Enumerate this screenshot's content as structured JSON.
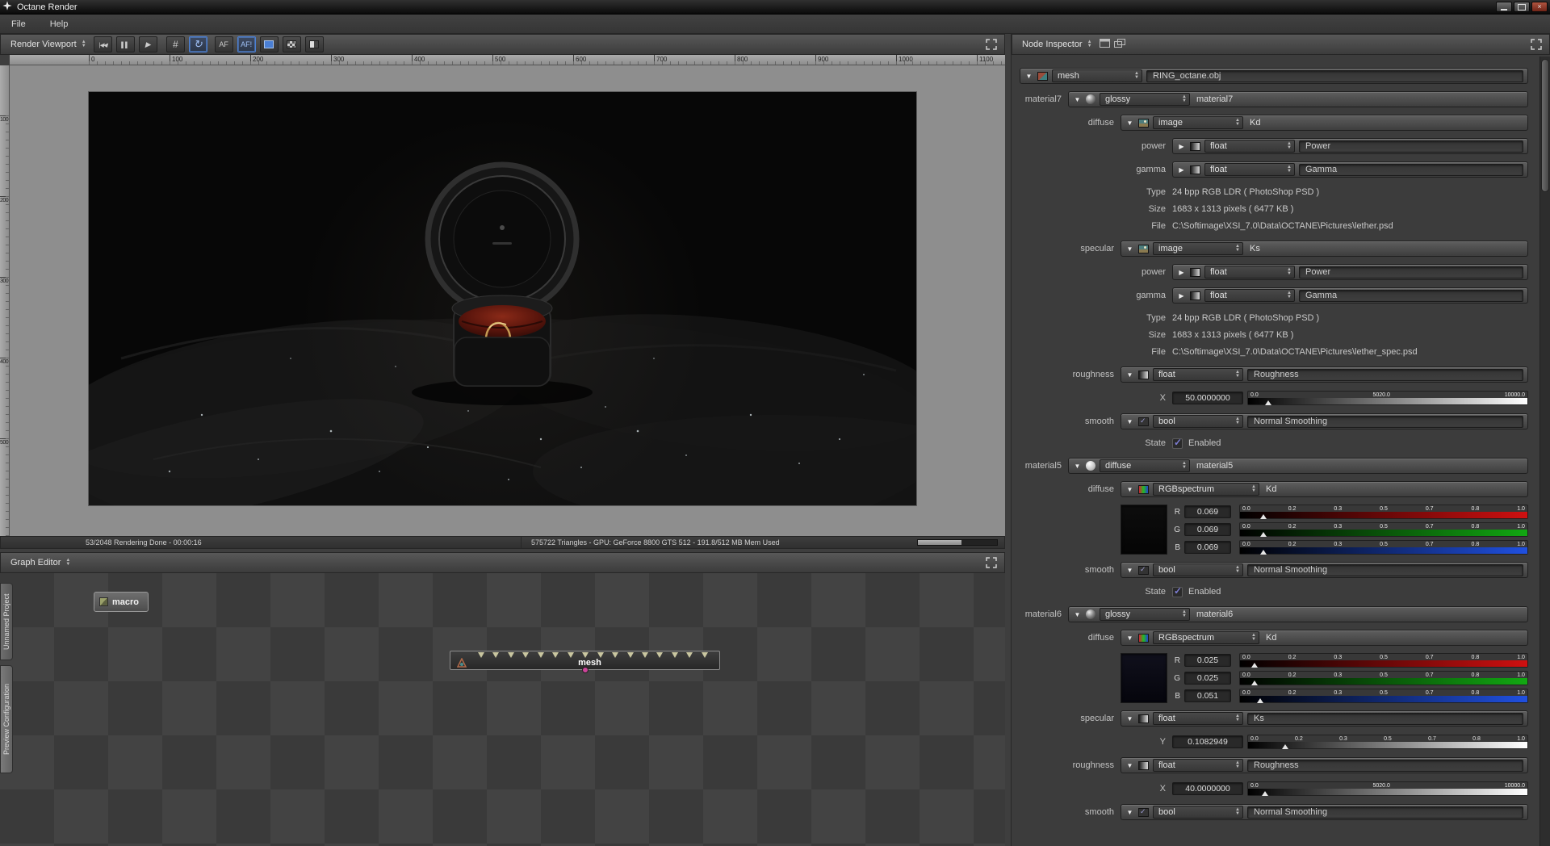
{
  "colors": {
    "accent": "#4a7fd4",
    "check": "#7d7dd4",
    "red": "#d01010",
    "green": "#12a812",
    "blue": "#2050e0",
    "pin": "#c9c6a0",
    "outpin": "#cc4499"
  },
  "window": {
    "title": "Octane Render",
    "menu_file": "File",
    "menu_help": "Help"
  },
  "viewport": {
    "title": "Render Viewport",
    "af": "AF",
    "af2": "AF!",
    "ruler_h": [
      "0",
      "100",
      "200",
      "300",
      "400",
      "500",
      "600",
      "700",
      "800",
      "900",
      "1000",
      "1100"
    ],
    "ruler_v": [
      "100",
      "200",
      "300",
      "400",
      "500"
    ],
    "status_left": "53/2048 Rendering Done - 00:00:16",
    "status_right": "575722 Triangles - GPU: GeForce 8800 GTS 512 - 191.8/512 MB Mem Used"
  },
  "graph": {
    "title": "Graph Editor",
    "tab_project": "Unnamed Project",
    "tab_preview": "Preview Configuration",
    "macro": "macro",
    "mesh": "mesh"
  },
  "inspector": {
    "title": "Node Inspector",
    "mesh_type": "mesh",
    "mesh_file": "RING_octane.obj",
    "ticks_unit": [
      "0.0",
      "0.2",
      "0.3",
      "0.5",
      "0.7",
      "0.8",
      "1.0"
    ],
    "ticks_rough": [
      "0.0",
      "5020.0",
      "10000.0"
    ],
    "m7": {
      "label": "material7",
      "type": "glossy",
      "name": "material7",
      "diffuse": {
        "label": "diffuse",
        "type": "image",
        "pin": "Kd"
      },
      "d_power": {
        "label": "power",
        "type": "float",
        "pin": "Power"
      },
      "d_gamma": {
        "label": "gamma",
        "type": "float",
        "pin": "Gamma"
      },
      "d_type_l": "Type",
      "d_type": "24 bpp RGB LDR ( PhotoShop PSD )",
      "d_size_l": "Size",
      "d_size": "1683 x 1313 pixels ( 6477 KB )",
      "d_file_l": "File",
      "d_file": "C:\\Softimage\\XSI_7.0\\Data\\OCTANE\\Pictures\\lether.psd",
      "specular": {
        "label": "specular",
        "type": "image",
        "pin": "Ks"
      },
      "s_power": {
        "label": "power",
        "type": "float",
        "pin": "Power"
      },
      "s_gamma": {
        "label": "gamma",
        "type": "float",
        "pin": "Gamma"
      },
      "s_type_l": "Type",
      "s_type": "24 bpp RGB LDR ( PhotoShop PSD )",
      "s_size_l": "Size",
      "s_size": "1683 x 1313 pixels ( 6477 KB )",
      "s_file_l": "File",
      "s_file": "C:\\Softimage\\XSI_7.0\\Data\\OCTANE\\Pictures\\lether_spec.psd",
      "roughness": {
        "label": "roughness",
        "type": "float",
        "pin": "Roughness"
      },
      "x_label": "X",
      "x_value": "50.0000000",
      "smooth": {
        "label": "smooth",
        "type": "bool",
        "pin": "Normal Smoothing"
      },
      "state_label": "State",
      "state_value": "Enabled"
    },
    "m5": {
      "label": "material5",
      "type": "diffuse",
      "name": "material5",
      "diffuse": {
        "label": "diffuse",
        "type": "RGBspectrum",
        "pin": "Kd"
      },
      "r_l": "R",
      "r": "0.069",
      "g_l": "G",
      "g": "0.069",
      "b_l": "B",
      "b": "0.069",
      "smooth": {
        "label": "smooth",
        "type": "bool",
        "pin": "Normal Smoothing"
      },
      "state_label": "State",
      "state_value": "Enabled"
    },
    "m6": {
      "label": "material6",
      "type": "glossy",
      "name": "material6",
      "diffuse": {
        "label": "diffuse",
        "type": "RGBspectrum",
        "pin": "Kd"
      },
      "r_l": "R",
      "r": "0.025",
      "g_l": "G",
      "g": "0.025",
      "b_l": "B",
      "b": "0.051",
      "specular": {
        "label": "specular",
        "type": "float",
        "pin": "Ks"
      },
      "y_label": "Y",
      "y_value": "0.1082949",
      "roughness": {
        "label": "roughness",
        "type": "float",
        "pin": "Roughness"
      },
      "x_label": "X",
      "x_value": "40.0000000",
      "smooth": {
        "label": "smooth",
        "type": "bool",
        "pin": "Normal Smoothing"
      }
    }
  }
}
